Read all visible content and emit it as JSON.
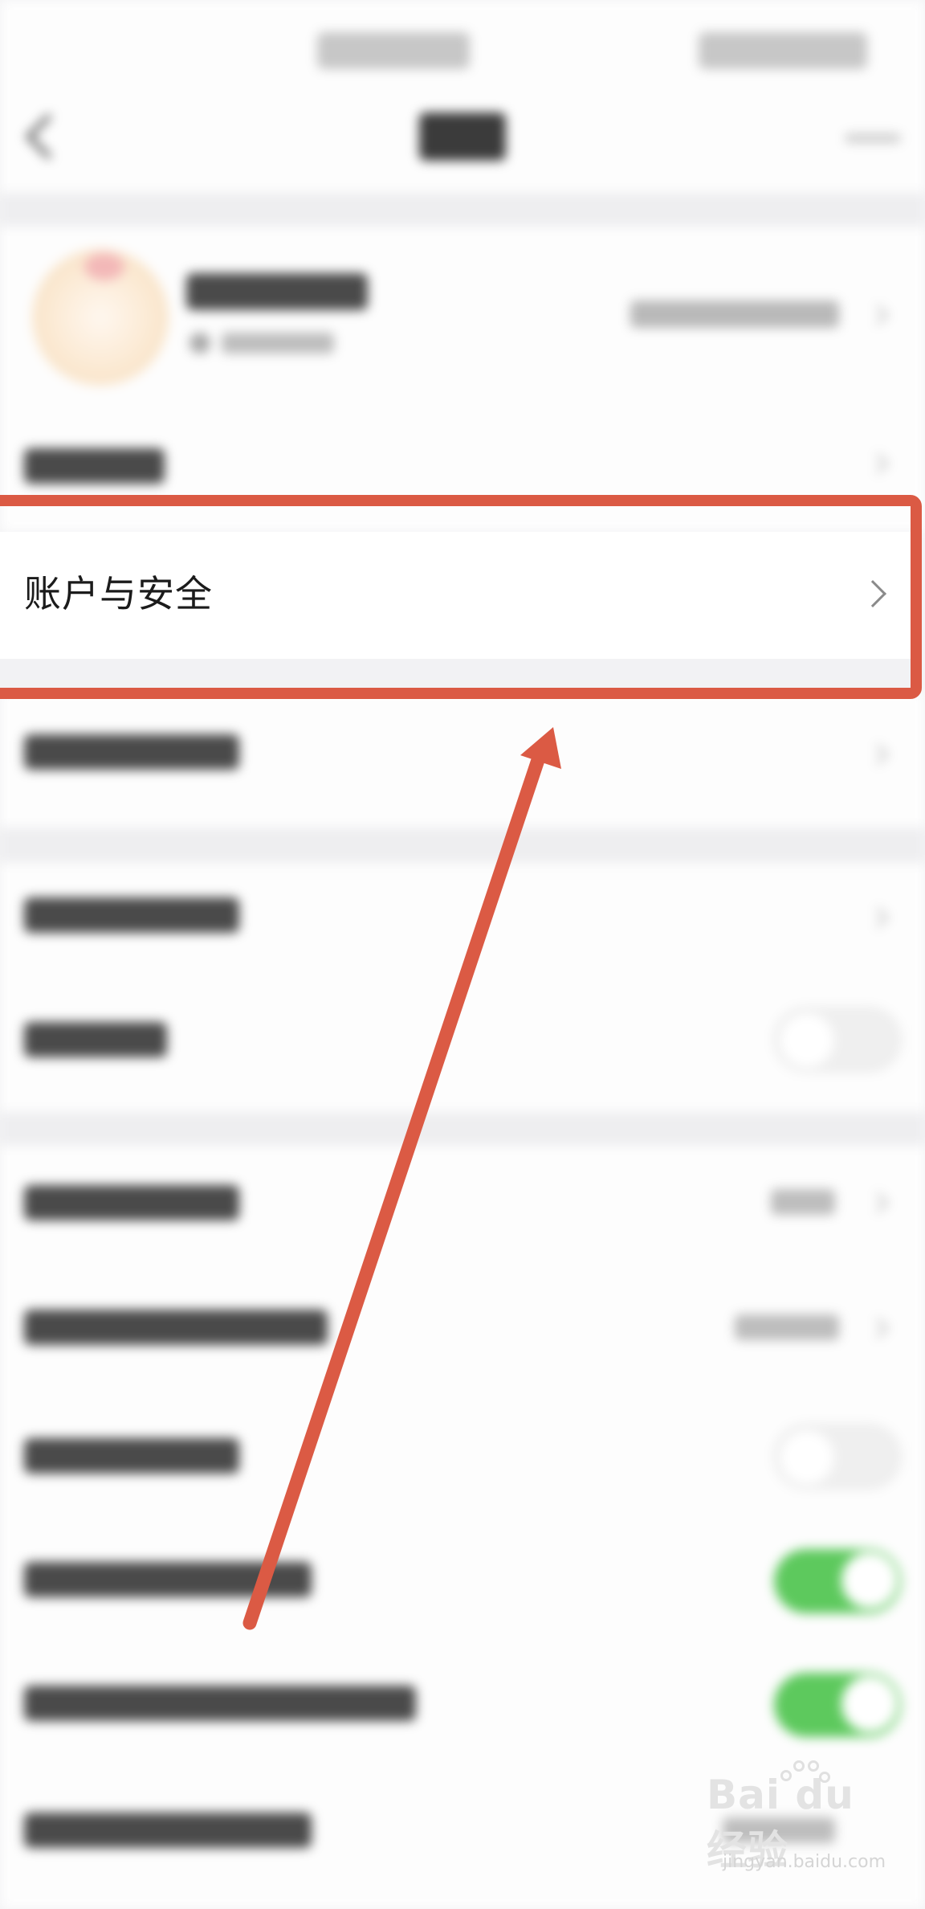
{
  "settings": {
    "highlighted_row": {
      "label": "账户与安全"
    }
  },
  "watermark": {
    "logo": "Bai du 经验",
    "url": "jingyan.baidu.com"
  },
  "colors": {
    "annotation_red": "#db5a44",
    "toggle_on_green": "#5dc95d",
    "background": "#f3f3f5"
  },
  "icons": [
    "back-arrow-icon",
    "more-icon",
    "chevron-right-icon",
    "baidu-paw-icon"
  ]
}
